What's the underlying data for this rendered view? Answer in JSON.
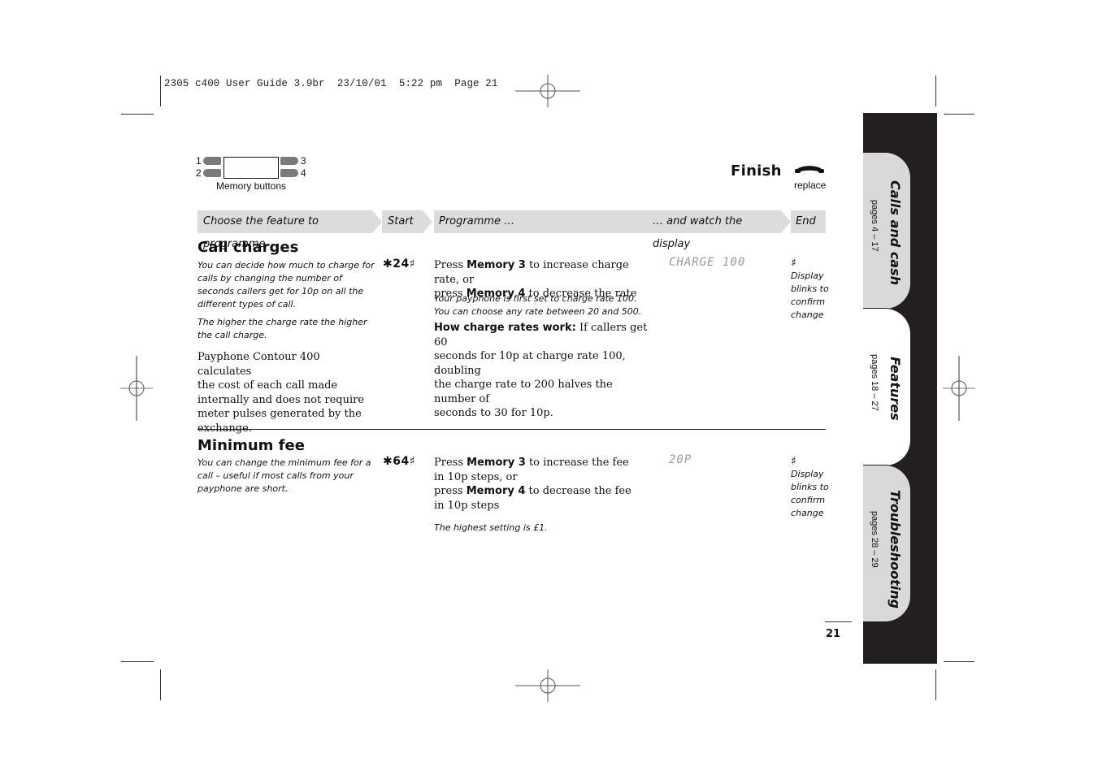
{
  "slug": "2305 c400 User Guide 3.9br  23/10/01  5:22 pm  Page 21",
  "memory_buttons": {
    "numbers": [
      "1",
      "2",
      "3",
      "4"
    ],
    "label": "Memory buttons"
  },
  "finish": {
    "title": "Finish",
    "icon": "handset-icon",
    "caption": "replace"
  },
  "header_bar": {
    "choose": "Choose the feature to programme",
    "start": "Start",
    "programme": "Programme …",
    "watch": "… and watch the display",
    "end": "End"
  },
  "sections": [
    {
      "title": "Call charges",
      "intro": [
        "You can decide how much to charge for",
        "calls by changing the number of",
        "seconds callers get for 10p on all the",
        "different types of call."
      ],
      "intro2": [
        "The higher the charge rate the higher",
        "the call charge."
      ],
      "body": [
        "Payphone Contour 400 calculates",
        "the cost of each call made",
        "internally and does not require",
        "meter pulses generated by the",
        "exchange."
      ],
      "code": "✱24♯",
      "steps": {
        "line1_pre": "Press ",
        "line1_bold": "Memory 3",
        "line1_post": " to increase charge rate, or",
        "line2_pre": "press ",
        "line2_bold": "Memory 4",
        "line2_post": " to decrease the rate"
      },
      "note": [
        "Your payphone is first set to charge rate 100.",
        "You can choose any rate between 20 and 500."
      ],
      "how_title": "How charge rates work:",
      "how_text": [
        " If callers get 60",
        "seconds for 10p at charge rate 100, doubling",
        "the charge rate to 200 halves the number of",
        "seconds to 30 for 10p."
      ],
      "display": "CHARGE 100",
      "end_symbol": "♯",
      "end_text": [
        "Display",
        "blinks to",
        "confirm",
        "change"
      ]
    },
    {
      "title": "Minimum fee",
      "intro": [
        "You can change the minimum fee for a",
        "call – useful if most calls from your",
        "payphone are short."
      ],
      "code": "✱64♯",
      "steps": {
        "line1_pre": "Press ",
        "line1_bold": "Memory 3",
        "line1_post": " to increase the fee",
        "line2": "in 10p steps, or",
        "line3_pre": "press ",
        "line3_bold": "Memory 4",
        "line3_post": " to decrease the fee",
        "line4": "in 10p steps"
      },
      "note": "The highest setting is £1.",
      "display": "20P",
      "end_symbol": "♯",
      "end_text": [
        "Display",
        "blinks to",
        "confirm",
        "change"
      ]
    }
  ],
  "tabs": [
    {
      "title": "Calls and cash",
      "pages": "pages 4 – 17",
      "active": false
    },
    {
      "title": "Features",
      "pages": "pages 18 – 27",
      "active": true
    },
    {
      "title": "Troubleshooting",
      "pages": "pages 28 – 29",
      "active": false
    }
  ],
  "page_number": "21"
}
